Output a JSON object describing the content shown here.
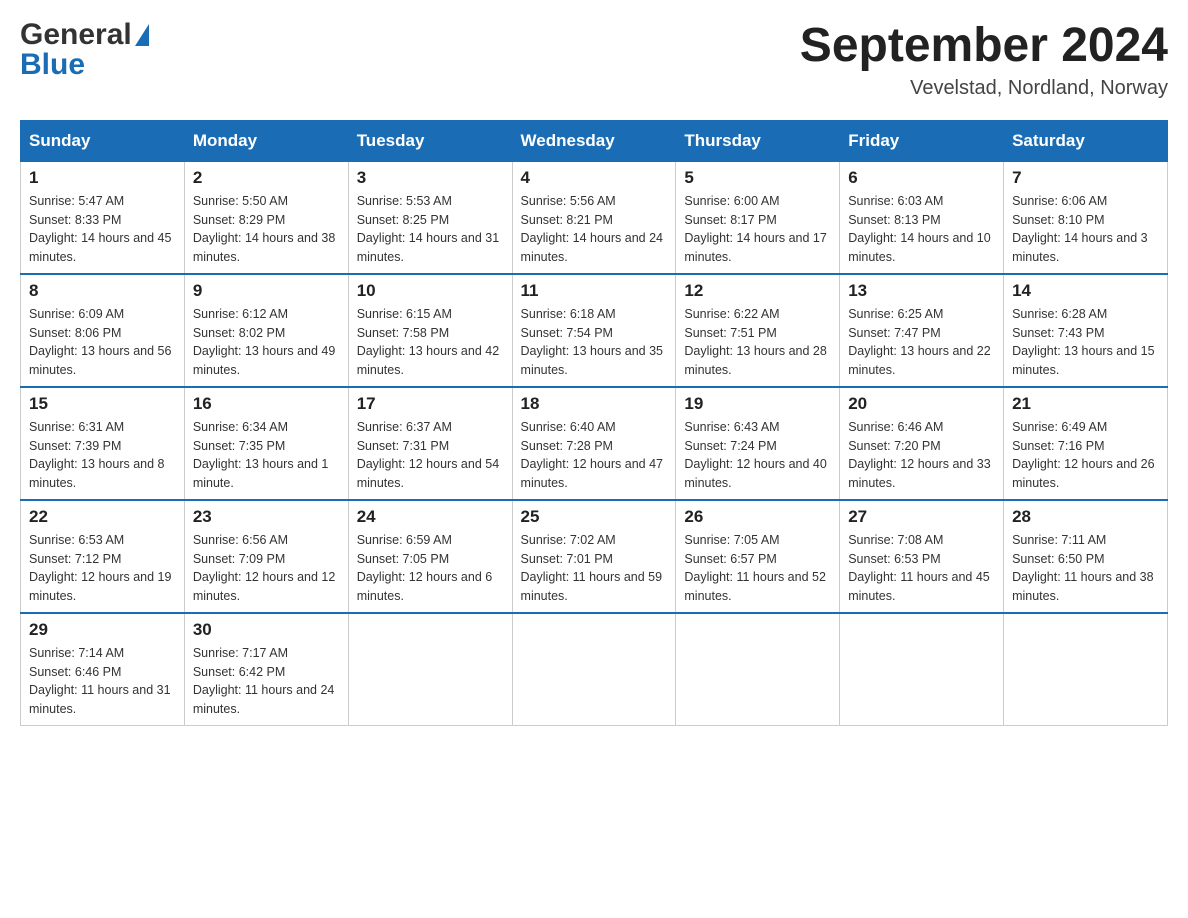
{
  "header": {
    "logo": {
      "general": "General",
      "blue": "Blue"
    },
    "title": "September 2024",
    "location": "Vevelstad, Nordland, Norway"
  },
  "days_of_week": [
    "Sunday",
    "Monday",
    "Tuesday",
    "Wednesday",
    "Thursday",
    "Friday",
    "Saturday"
  ],
  "weeks": [
    [
      {
        "day": "1",
        "sunrise": "5:47 AM",
        "sunset": "8:33 PM",
        "daylight": "14 hours and 45 minutes."
      },
      {
        "day": "2",
        "sunrise": "5:50 AM",
        "sunset": "8:29 PM",
        "daylight": "14 hours and 38 minutes."
      },
      {
        "day": "3",
        "sunrise": "5:53 AM",
        "sunset": "8:25 PM",
        "daylight": "14 hours and 31 minutes."
      },
      {
        "day": "4",
        "sunrise": "5:56 AM",
        "sunset": "8:21 PM",
        "daylight": "14 hours and 24 minutes."
      },
      {
        "day": "5",
        "sunrise": "6:00 AM",
        "sunset": "8:17 PM",
        "daylight": "14 hours and 17 minutes."
      },
      {
        "day": "6",
        "sunrise": "6:03 AM",
        "sunset": "8:13 PM",
        "daylight": "14 hours and 10 minutes."
      },
      {
        "day": "7",
        "sunrise": "6:06 AM",
        "sunset": "8:10 PM",
        "daylight": "14 hours and 3 minutes."
      }
    ],
    [
      {
        "day": "8",
        "sunrise": "6:09 AM",
        "sunset": "8:06 PM",
        "daylight": "13 hours and 56 minutes."
      },
      {
        "day": "9",
        "sunrise": "6:12 AM",
        "sunset": "8:02 PM",
        "daylight": "13 hours and 49 minutes."
      },
      {
        "day": "10",
        "sunrise": "6:15 AM",
        "sunset": "7:58 PM",
        "daylight": "13 hours and 42 minutes."
      },
      {
        "day": "11",
        "sunrise": "6:18 AM",
        "sunset": "7:54 PM",
        "daylight": "13 hours and 35 minutes."
      },
      {
        "day": "12",
        "sunrise": "6:22 AM",
        "sunset": "7:51 PM",
        "daylight": "13 hours and 28 minutes."
      },
      {
        "day": "13",
        "sunrise": "6:25 AM",
        "sunset": "7:47 PM",
        "daylight": "13 hours and 22 minutes."
      },
      {
        "day": "14",
        "sunrise": "6:28 AM",
        "sunset": "7:43 PM",
        "daylight": "13 hours and 15 minutes."
      }
    ],
    [
      {
        "day": "15",
        "sunrise": "6:31 AM",
        "sunset": "7:39 PM",
        "daylight": "13 hours and 8 minutes."
      },
      {
        "day": "16",
        "sunrise": "6:34 AM",
        "sunset": "7:35 PM",
        "daylight": "13 hours and 1 minute."
      },
      {
        "day": "17",
        "sunrise": "6:37 AM",
        "sunset": "7:31 PM",
        "daylight": "12 hours and 54 minutes."
      },
      {
        "day": "18",
        "sunrise": "6:40 AM",
        "sunset": "7:28 PM",
        "daylight": "12 hours and 47 minutes."
      },
      {
        "day": "19",
        "sunrise": "6:43 AM",
        "sunset": "7:24 PM",
        "daylight": "12 hours and 40 minutes."
      },
      {
        "day": "20",
        "sunrise": "6:46 AM",
        "sunset": "7:20 PM",
        "daylight": "12 hours and 33 minutes."
      },
      {
        "day": "21",
        "sunrise": "6:49 AM",
        "sunset": "7:16 PM",
        "daylight": "12 hours and 26 minutes."
      }
    ],
    [
      {
        "day": "22",
        "sunrise": "6:53 AM",
        "sunset": "7:12 PM",
        "daylight": "12 hours and 19 minutes."
      },
      {
        "day": "23",
        "sunrise": "6:56 AM",
        "sunset": "7:09 PM",
        "daylight": "12 hours and 12 minutes."
      },
      {
        "day": "24",
        "sunrise": "6:59 AM",
        "sunset": "7:05 PM",
        "daylight": "12 hours and 6 minutes."
      },
      {
        "day": "25",
        "sunrise": "7:02 AM",
        "sunset": "7:01 PM",
        "daylight": "11 hours and 59 minutes."
      },
      {
        "day": "26",
        "sunrise": "7:05 AM",
        "sunset": "6:57 PM",
        "daylight": "11 hours and 52 minutes."
      },
      {
        "day": "27",
        "sunrise": "7:08 AM",
        "sunset": "6:53 PM",
        "daylight": "11 hours and 45 minutes."
      },
      {
        "day": "28",
        "sunrise": "7:11 AM",
        "sunset": "6:50 PM",
        "daylight": "11 hours and 38 minutes."
      }
    ],
    [
      {
        "day": "29",
        "sunrise": "7:14 AM",
        "sunset": "6:46 PM",
        "daylight": "11 hours and 31 minutes."
      },
      {
        "day": "30",
        "sunrise": "7:17 AM",
        "sunset": "6:42 PM",
        "daylight": "11 hours and 24 minutes."
      },
      null,
      null,
      null,
      null,
      null
    ]
  ]
}
